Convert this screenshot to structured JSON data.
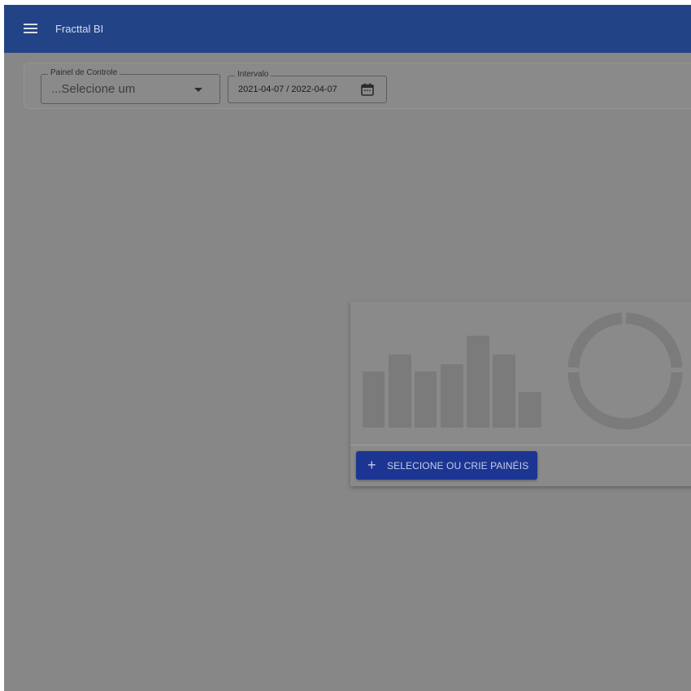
{
  "header": {
    "app_title": "Fracttal BI",
    "menu_icon": "hamburger-menu-icon",
    "background_color": "#234387"
  },
  "filters": {
    "dashboard_select": {
      "label": "Painel de Controle",
      "value": "...Selecione um",
      "icon": "dropdown-arrow-icon"
    },
    "date_range": {
      "label": "Intervalo",
      "value": "2021-04-07 / 2022-04-07",
      "icon": "calendar-icon"
    }
  },
  "empty_state": {
    "illustration": "placeholder-bar-chart-and-donut",
    "button_label": "SELECIONE OU CRIE PAINÉIS",
    "button_icon": "plus-icon",
    "button_color": "#1c3593"
  }
}
